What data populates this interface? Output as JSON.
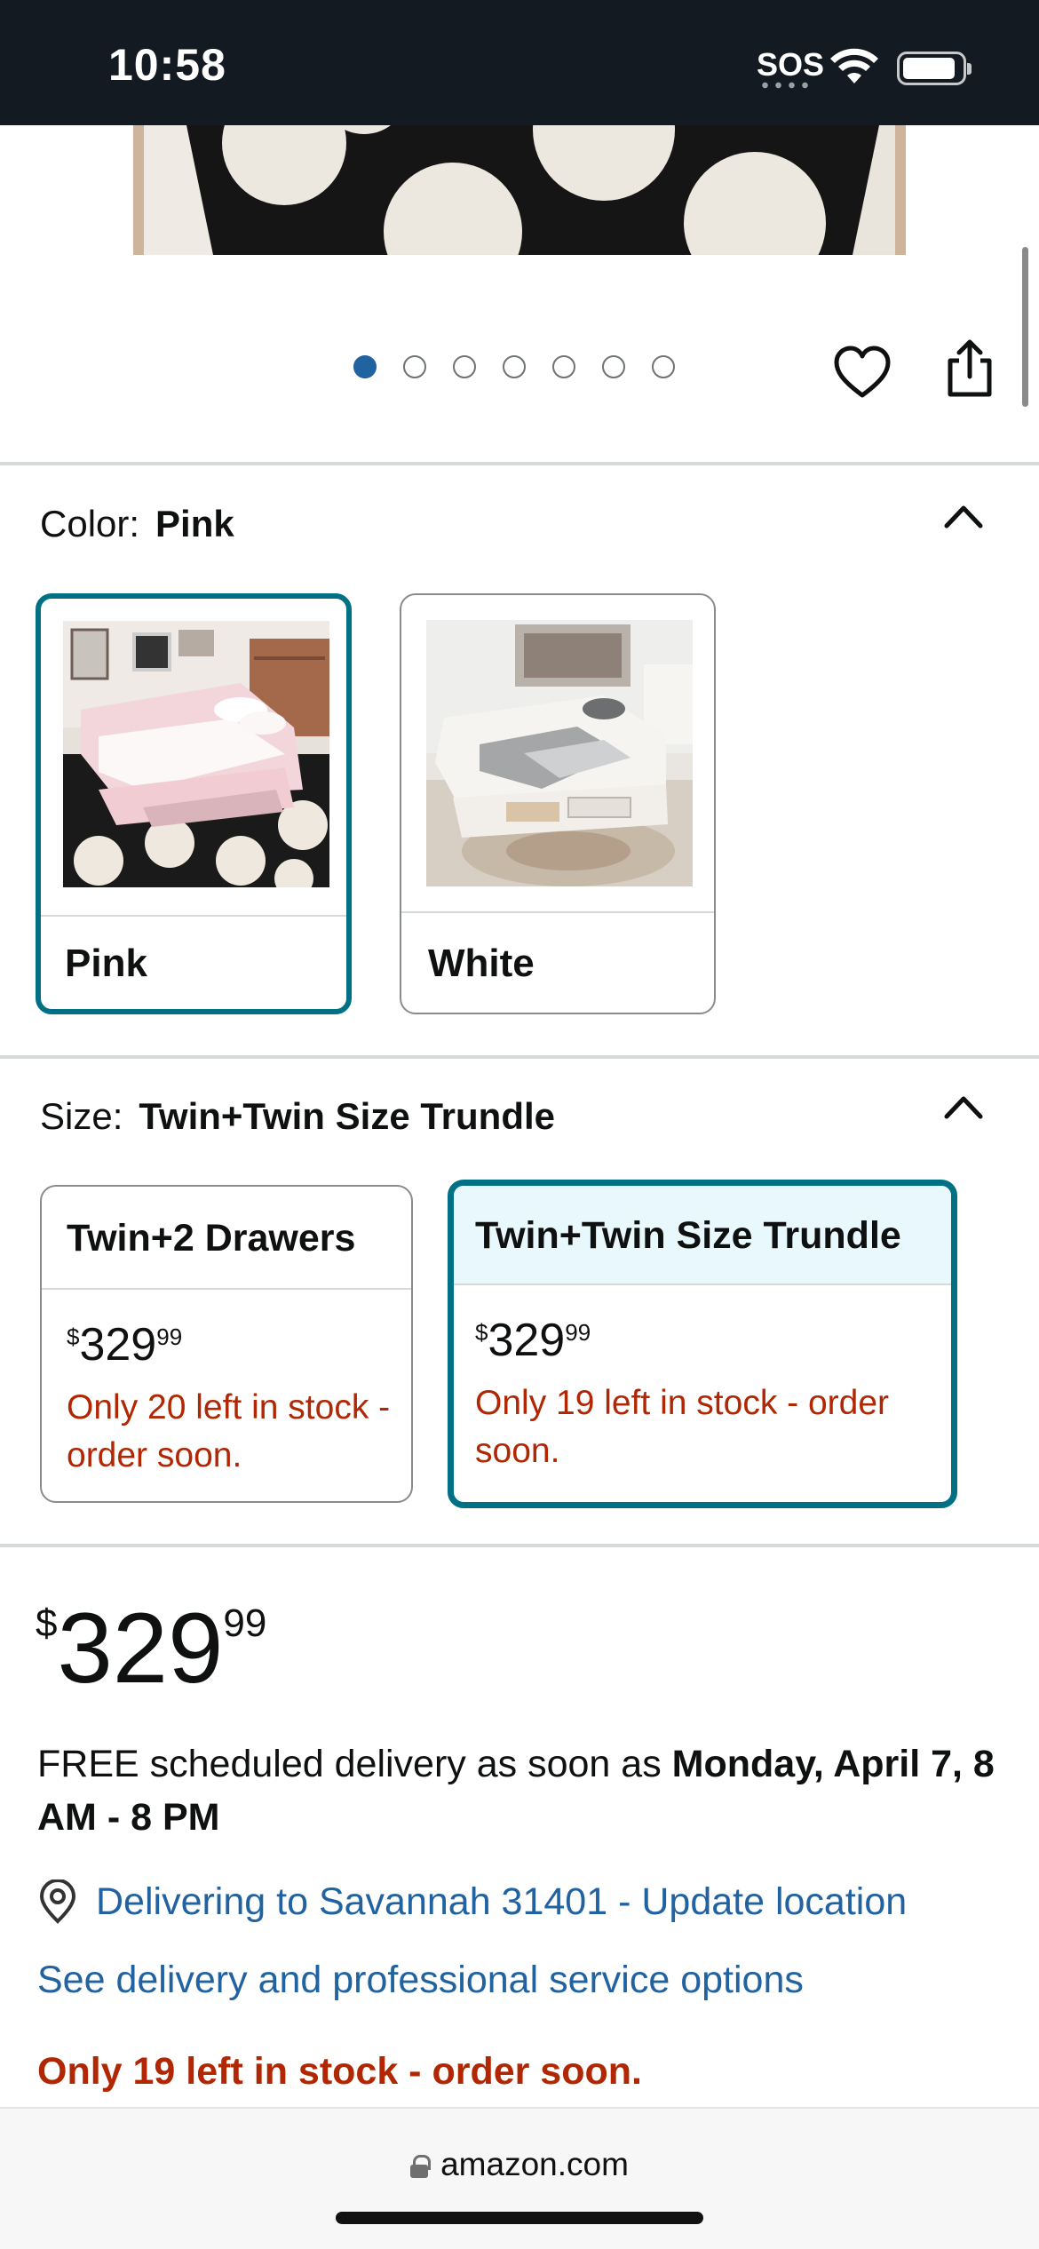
{
  "status_bar": {
    "time": "10:58",
    "sos": "SOS"
  },
  "gallery": {
    "total_dots": 7,
    "active_index": 0
  },
  "color": {
    "label": "Color:",
    "selected": "Pink",
    "options": [
      {
        "name": "Pink",
        "selected": true
      },
      {
        "name": "White",
        "selected": false
      }
    ]
  },
  "size": {
    "label": "Size:",
    "selected": "Twin+Twin Size Trundle",
    "options": [
      {
        "name": "Twin+2 Drawers",
        "price_currency": "$",
        "price_whole": "329",
        "price_fraction": "99",
        "stock": "Only 20 left in stock - order soon.",
        "selected": false
      },
      {
        "name": "Twin+Twin Size Trundle",
        "price_currency": "$",
        "price_whole": "329",
        "price_fraction": "99",
        "stock": "Only 19 left in stock - order soon.",
        "selected": true
      }
    ]
  },
  "price": {
    "currency": "$",
    "whole": "329",
    "fraction": "99"
  },
  "delivery": {
    "prefix": "FREE scheduled delivery as soon as ",
    "date": "Monday, April 7, 8 AM - 8 PM",
    "location_link": "Delivering to Savannah 31401 - Update location",
    "options_link": "See delivery and professional service options"
  },
  "stock_status": "Only 19 left in stock - order soon.",
  "browser": {
    "url": "amazon.com"
  },
  "colors": {
    "accent": "#007185",
    "link": "#2162a1",
    "alert": "#b12704",
    "dot_active": "#2162a1"
  }
}
